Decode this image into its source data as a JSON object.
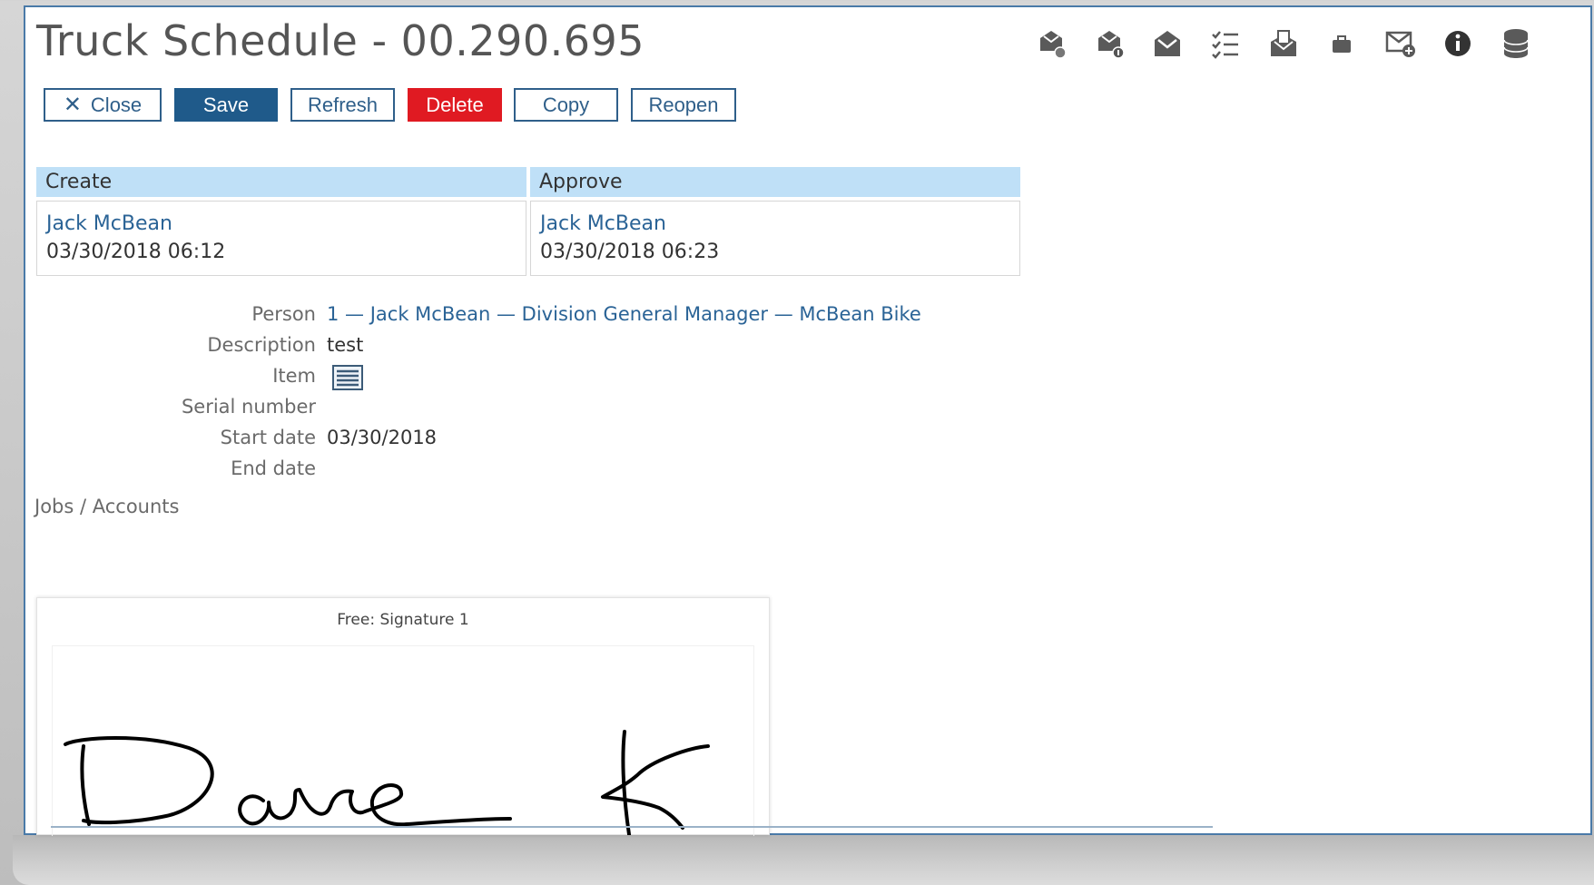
{
  "page": {
    "title": "Truck Schedule - 00.290.695"
  },
  "toolbar_icons": [
    {
      "name": "mail-settings-icon"
    },
    {
      "name": "mail-info-icon"
    },
    {
      "name": "open-envelope-icon"
    },
    {
      "name": "checklist-icon"
    },
    {
      "name": "envelope-attachment-icon"
    },
    {
      "name": "briefcase-icon"
    },
    {
      "name": "email-add-icon"
    },
    {
      "name": "info-icon"
    },
    {
      "name": "database-icon"
    }
  ],
  "buttons": {
    "close": "Close",
    "save": "Save",
    "refresh": "Refresh",
    "delete": "Delete",
    "copy": "Copy",
    "reopen": "Reopen"
  },
  "approval": {
    "create": {
      "header": "Create",
      "name": "Jack McBean",
      "date": "03/30/2018 06:12"
    },
    "approve": {
      "header": "Approve",
      "name": "Jack McBean",
      "date": "03/30/2018 06:23"
    }
  },
  "fields": {
    "person_label": "Person",
    "person_value": "1 — Jack McBean — Division General Manager — McBean Bike",
    "description_label": "Description",
    "description_value": "test",
    "item_label": "Item",
    "serial_label": "Serial number",
    "start_label": "Start date",
    "start_value": "03/30/2018",
    "end_label": "End date"
  },
  "jobs_label": "Jobs / Accounts",
  "signature": {
    "title": "Free: Signature 1",
    "handwriting": "Dave K"
  },
  "colors": {
    "primary": "#1f5a8a",
    "danger": "#e01a22",
    "header_bg": "#bfe0f7",
    "link": "#2a6396"
  }
}
